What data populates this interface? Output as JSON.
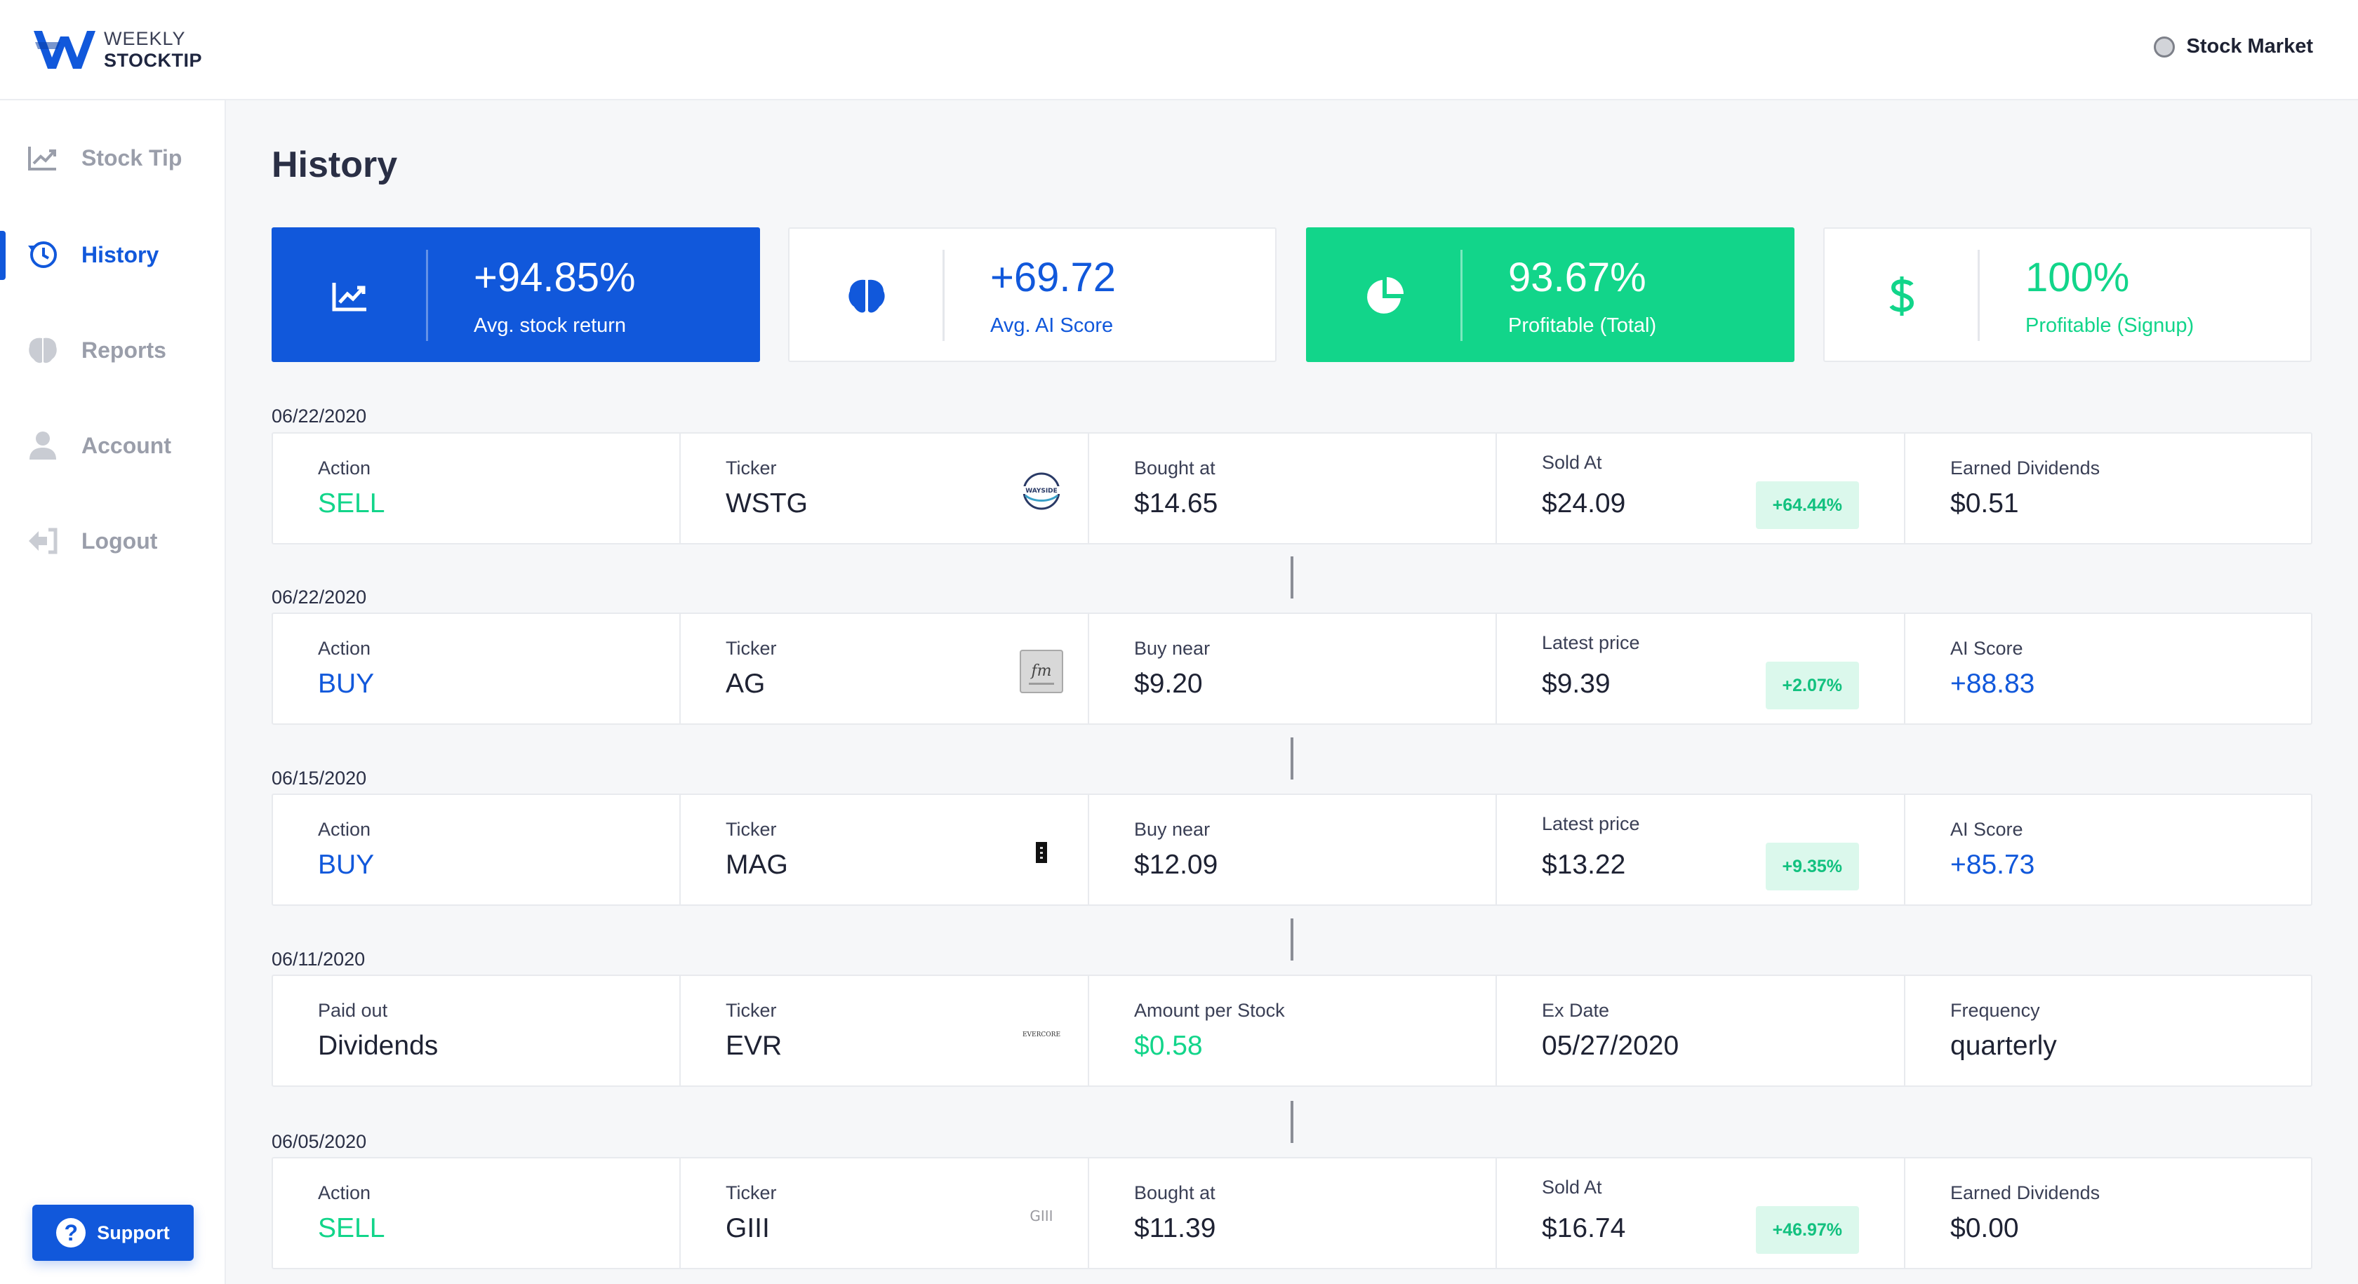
{
  "brand": {
    "line1": "WEEKLY",
    "line2": "STOCKTIP"
  },
  "header": {
    "market_label": "Stock Market"
  },
  "sidebar": {
    "items": [
      {
        "label": "Stock Tip",
        "icon": "chart-line-icon"
      },
      {
        "label": "History",
        "icon": "history-clock-icon",
        "active": true
      },
      {
        "label": "Reports",
        "icon": "brain-icon"
      },
      {
        "label": "Account",
        "icon": "user-icon"
      },
      {
        "label": "Logout",
        "icon": "logout-icon"
      }
    ],
    "support_label": "Support"
  },
  "page": {
    "title": "History"
  },
  "stats": [
    {
      "value": "+94.85%",
      "label": "Avg. stock return",
      "icon": "chart-line-icon"
    },
    {
      "value": "+69.72",
      "label": "Avg. AI Score",
      "icon": "brain-icon"
    },
    {
      "value": "93.67%",
      "label": "Profitable (Total)",
      "icon": "pie-chart-icon"
    },
    {
      "value": "100%",
      "label": "Profitable (Signup)",
      "icon": "dollar-icon"
    }
  ],
  "entries": [
    {
      "date": "06/22/2020",
      "action_label": "Action",
      "action": "SELL",
      "ticker_label": "Ticker",
      "ticker": "WSTG",
      "ticker_logo_text": "WAYSIDE",
      "c3_label": "Bought at",
      "c3_value": "$14.65",
      "c4_label": "Sold At",
      "c4_value": "$24.09",
      "badge": "+64.44%",
      "c5_label": "Earned Dividends",
      "c5_value": "$0.51"
    },
    {
      "date": "06/22/2020",
      "action_label": "Action",
      "action": "BUY",
      "ticker_label": "Ticker",
      "ticker": "AG",
      "ticker_logo_text": "fm",
      "c3_label": "Buy near",
      "c3_value": "$9.20",
      "c4_label": "Latest price",
      "c4_value": "$9.39",
      "badge": "+2.07%",
      "c5_label": "AI Score",
      "c5_value": "+88.83"
    },
    {
      "date": "06/15/2020",
      "action_label": "Action",
      "action": "BUY",
      "ticker_label": "Ticker",
      "ticker": "MAG",
      "c3_label": "Buy near",
      "c3_value": "$12.09",
      "c4_label": "Latest price",
      "c4_value": "$13.22",
      "badge": "+9.35%",
      "c5_label": "AI Score",
      "c5_value": "+85.73"
    },
    {
      "date": "06/11/2020",
      "action_label": "Paid out",
      "action": "Dividends",
      "ticker_label": "Ticker",
      "ticker": "EVR",
      "ticker_logo_text": "EVERCORE",
      "c3_label": "Amount per Stock",
      "c3_value": "$0.58",
      "c4_label": "Ex Date",
      "c4_value": "05/27/2020",
      "c5_label": "Frequency",
      "c5_value": "quarterly"
    },
    {
      "date": "06/05/2020",
      "action_label": "Action",
      "action": "SELL",
      "ticker_label": "Ticker",
      "ticker": "GIII",
      "ticker_logo_text": "GIII",
      "c3_label": "Bought at",
      "c3_value": "$11.39",
      "c4_label": "Sold At",
      "c4_value": "$16.74",
      "badge": "+46.97%",
      "c5_label": "Earned Dividends",
      "c5_value": "$0.00"
    }
  ],
  "colors": {
    "primary": "#1158db",
    "success": "#12d58a",
    "muted": "#9a9eaa"
  }
}
